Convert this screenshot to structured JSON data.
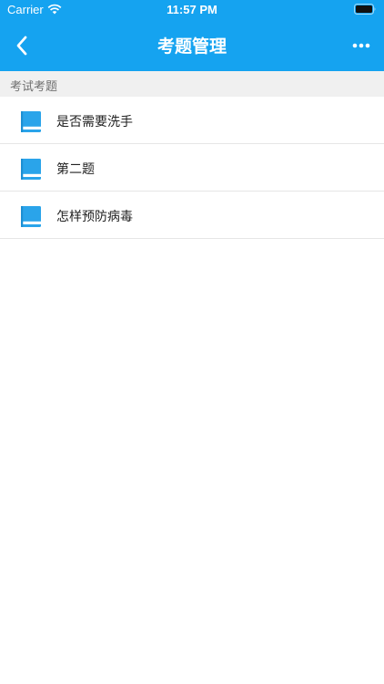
{
  "status_bar": {
    "carrier": "Carrier",
    "time": "11:57 PM"
  },
  "nav": {
    "title": "考题管理",
    "back_icon": "chevron-left-icon",
    "more_icon": "more-horizontal-icon"
  },
  "section": {
    "title": "考试考题"
  },
  "items": [
    {
      "label": "是否需要洗手",
      "icon": "book-icon"
    },
    {
      "label": "第二题",
      "icon": "book-icon"
    },
    {
      "label": "怎样预防病毒",
      "icon": "book-icon"
    }
  ],
  "colors": {
    "header_bg": "#15a3f0",
    "icon_blue": "#2aa4ea",
    "section_bg": "#f0f0f0"
  }
}
